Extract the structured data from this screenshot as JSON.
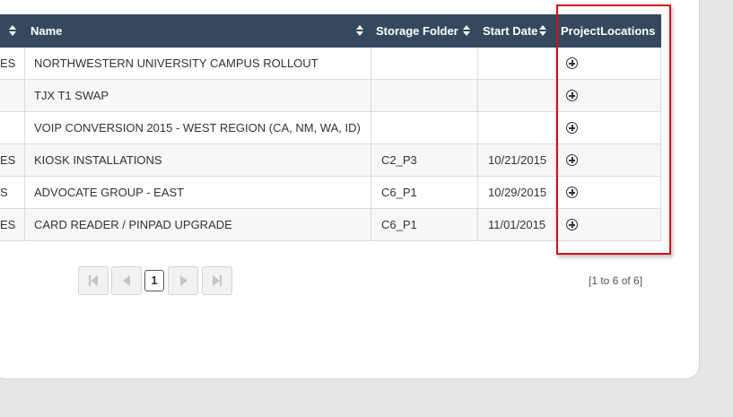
{
  "table": {
    "columns": [
      {
        "label": "Name"
      },
      {
        "label": "Storage Folder"
      },
      {
        "label": "Start Date"
      },
      {
        "label": "ProjectLocations"
      }
    ],
    "rows": [
      {
        "prefix": "ES",
        "name": "NORTHWESTERN UNIVERSITY CAMPUS ROLLOUT",
        "folder": "",
        "start": "",
        "location_icon": "add-circle-icon"
      },
      {
        "prefix": "",
        "name": "TJX T1 SWAP",
        "folder": "",
        "start": "",
        "location_icon": "add-circle-icon"
      },
      {
        "prefix": "",
        "name": "VOIP CONVERSION 2015 - WEST REGION (CA, NM, WA, ID)",
        "folder": "",
        "start": "",
        "location_icon": "add-circle-icon"
      },
      {
        "prefix": "ES",
        "name": "KIOSK INSTALLATIONS",
        "folder": "C2_P3",
        "start": "10/21/2015",
        "location_icon": "add-circle-icon"
      },
      {
        "prefix": "S",
        "name": "ADVOCATE GROUP - EAST",
        "folder": "C6_P1",
        "start": "10/29/2015",
        "location_icon": "add-circle-icon"
      },
      {
        "prefix": "ES",
        "name": "CARD READER / PINPAD UPGRADE",
        "folder": "C6_P1",
        "start": "11/01/2015",
        "location_icon": "add-circle-icon"
      }
    ]
  },
  "pager": {
    "current_page": "1",
    "summary": "[1 to 6 of 6]"
  },
  "colors": {
    "header_bg": "#34495e",
    "highlight": "#d0101a"
  }
}
